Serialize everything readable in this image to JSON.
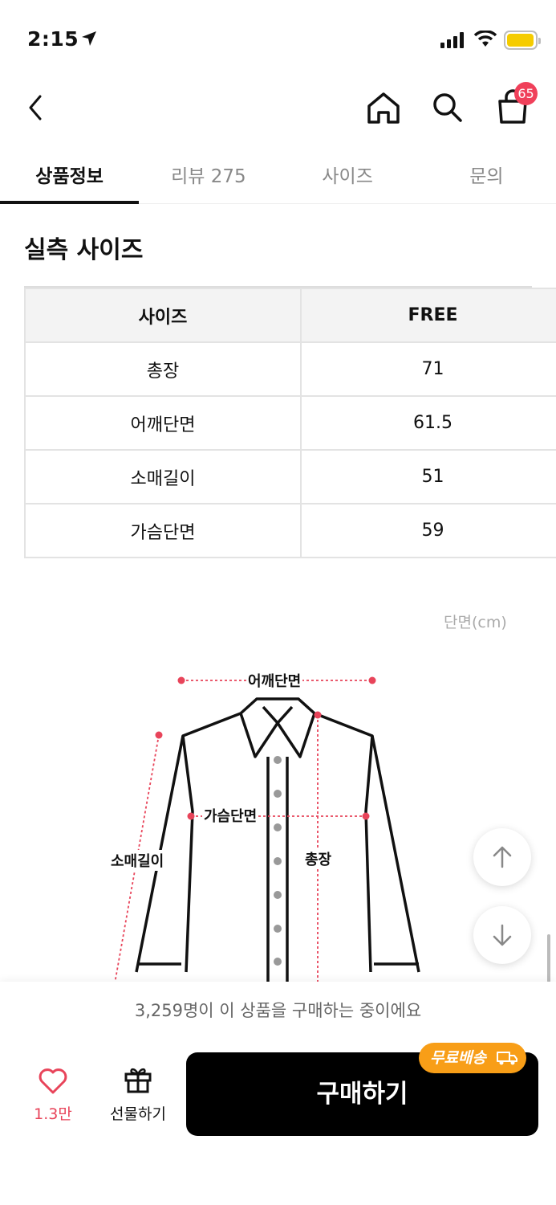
{
  "status": {
    "time": "2:15"
  },
  "nav": {
    "cart_count": "65"
  },
  "tabs": [
    {
      "label": "상품정보"
    },
    {
      "label": "리뷰 275"
    },
    {
      "label": "사이즈"
    },
    {
      "label": "문의"
    }
  ],
  "section_title": "실측 사이즈",
  "size_table": {
    "headers": [
      "사이즈",
      "FREE"
    ],
    "rows": [
      {
        "name": "총장",
        "value": "71"
      },
      {
        "name": "어깨단면",
        "value": "61.5"
      },
      {
        "name": "소매길이",
        "value": "51"
      },
      {
        "name": "가슴단면",
        "value": "59"
      }
    ]
  },
  "unit_note": "단면(cm)",
  "diagram_labels": {
    "shoulder": "어깨단면",
    "chest": "가슴단면",
    "sleeve": "소매길이",
    "length": "총장"
  },
  "bottom": {
    "notice": "3,259명이 이 상품을 구매하는 중이에요",
    "like_count": "1.3만",
    "gift_label": "선물하기",
    "buy_label": "구매하기",
    "free_shipping": "무료배송"
  },
  "colors": {
    "accent_red": "#e8445a",
    "badge": "#f0405a",
    "shipping_orange": "#f89e17",
    "battery": "#f5cc00"
  }
}
